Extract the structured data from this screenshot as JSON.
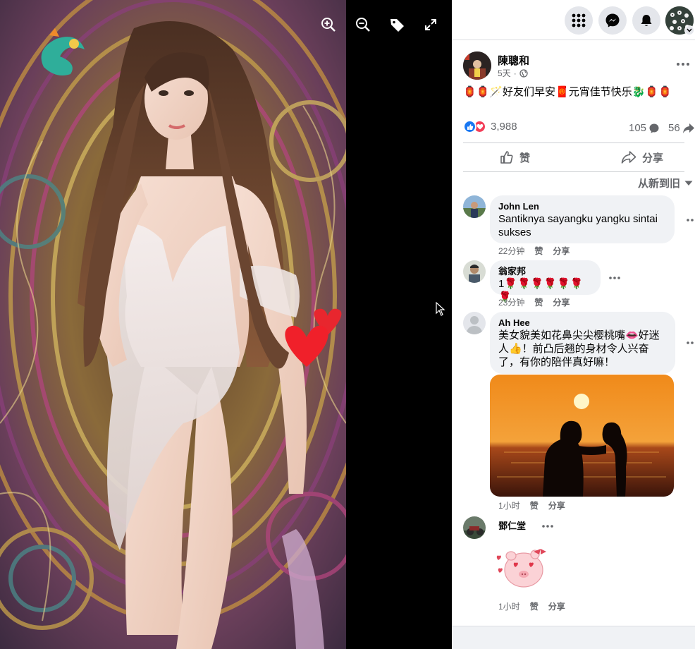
{
  "viewer": {
    "tools": [
      "zoom-in-icon",
      "zoom-out-icon",
      "tag-icon",
      "fullscreen-icon"
    ]
  },
  "post": {
    "author": "陳聰和",
    "time": "5天",
    "time_sep": "·",
    "text": "🏮🏮🪄好友们早安🧧元宵佳节快乐🐉🏮🏮",
    "reaction_count": "3,988",
    "comment_count": "105",
    "share_count": "56",
    "like_label": "赞",
    "share_label": "分享",
    "sort_label": "从新到旧"
  },
  "comments": [
    {
      "name": "John Len",
      "text_line1": "Santiknya sayangku yangku sintai",
      "text_line2": "sukses",
      "time": "22分钟",
      "like": "赞",
      "share": "分享"
    },
    {
      "name": "翁家邦",
      "text": "1🌹🌹🌹🌹🌹🌹🌹",
      "time": "23分钟",
      "like": "赞",
      "share": "分享"
    },
    {
      "name": "Ah Hee",
      "text_line1": "美女貌美如花鼻尖尖樱桃嘴👄好迷",
      "text_line2": "人👍！前凸后翘的身材令人兴奋",
      "text_line3": "了，有你的陪伴真好嘛！",
      "time": "1小时",
      "like": "赞",
      "share": "分享"
    },
    {
      "name": "鄧仁堂",
      "time": "1小时",
      "like": "赞",
      "share": "分享"
    }
  ],
  "colors": {
    "like_blue": "#1877f2",
    "love_red": "#f33e58",
    "secondary_text": "#65676b",
    "bubble_bg": "#f0f2f5"
  }
}
